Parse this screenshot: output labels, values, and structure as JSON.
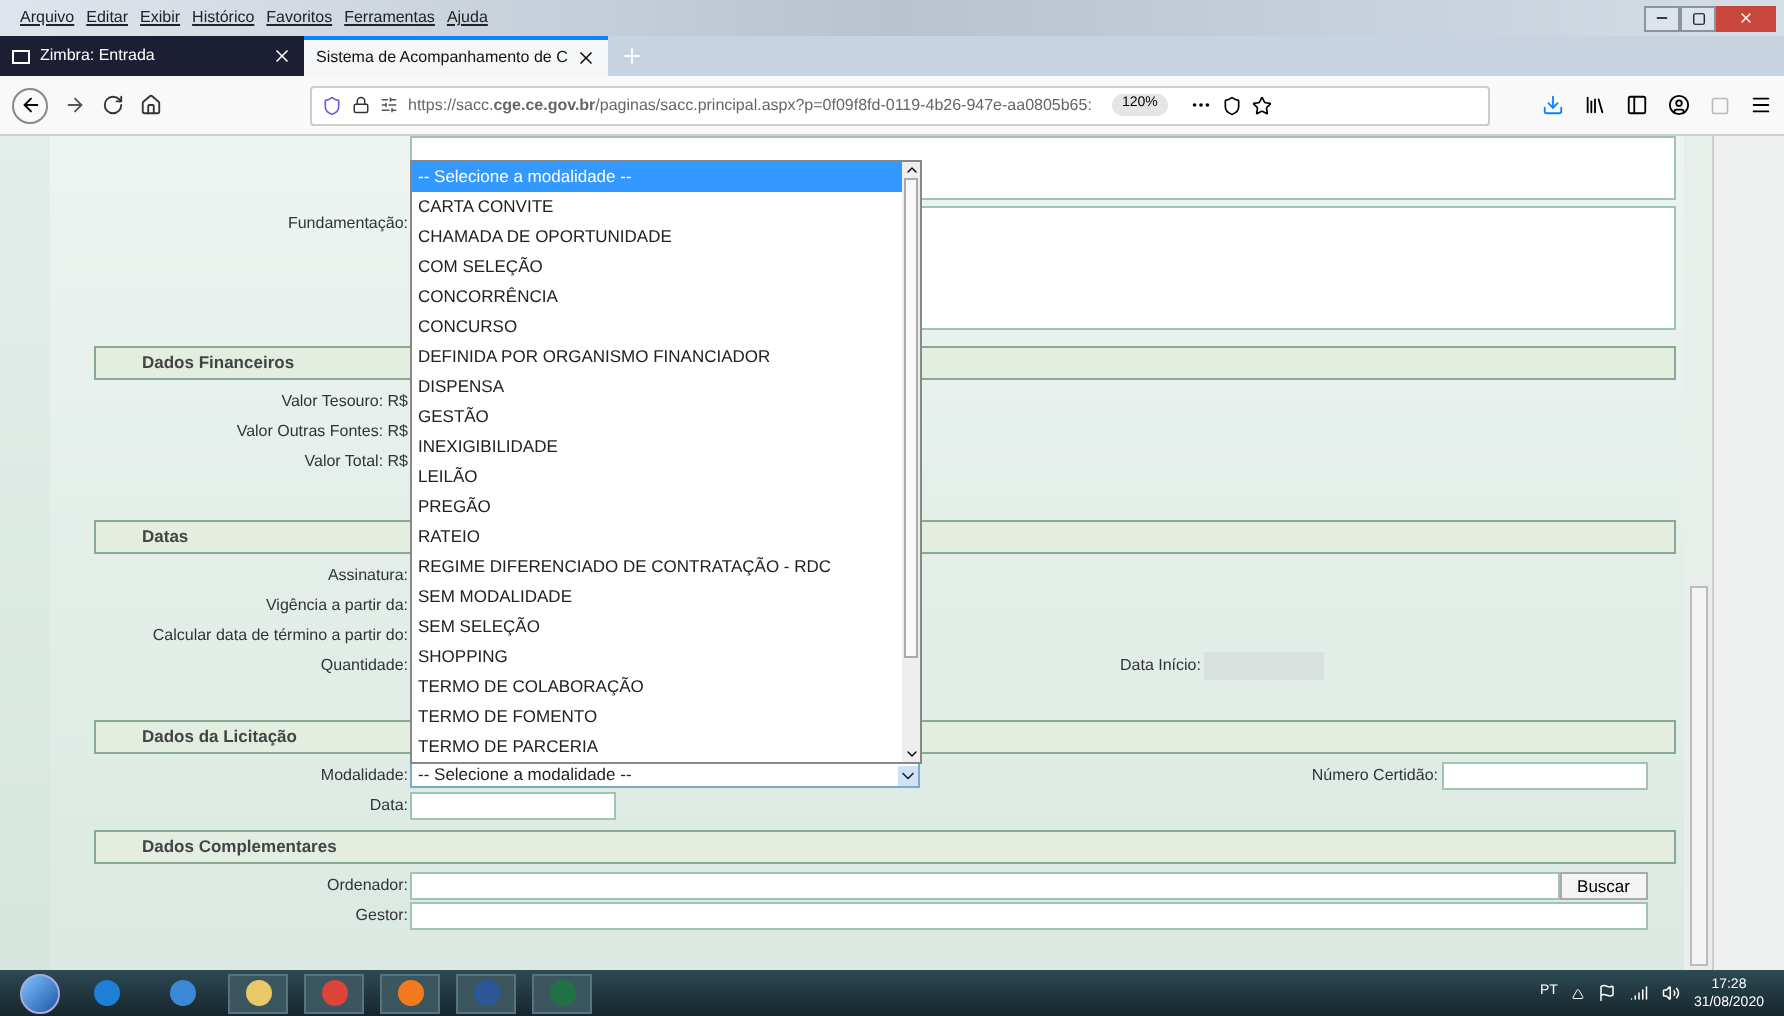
{
  "menu": [
    "Arquivo",
    "Editar",
    "Exibir",
    "Histórico",
    "Favoritos",
    "Ferramentas",
    "Ajuda"
  ],
  "tabs": [
    {
      "label": "Zimbra: Entrada",
      "selected": false
    },
    {
      "label": "Sistema de Acompanhamento de C",
      "selected": true
    }
  ],
  "address": {
    "url": "https://sacc.**cge.ce.gov.br**/paginas/sacc.principal.aspx?p=0f09f8fd-0119-4b26-947e-aa0805b65:",
    "zoom": "120%"
  },
  "fundamentacao": {
    "label": "Fundamentação:"
  },
  "sections": [
    {
      "title": "Dados Financeiros",
      "rows": [
        {
          "label": "Valor Tesouro: R$",
          "kind": "covered"
        },
        {
          "label": "Valor Outras Fontes: R$",
          "kind": "covered"
        },
        {
          "label": "Valor Total: R$",
          "kind": "covered"
        }
      ]
    },
    {
      "title": "Datas",
      "rows": [
        {
          "label": "Assinatura:",
          "kind": "covered"
        },
        {
          "label": "Vigência a partir da:",
          "kind": "covered"
        },
        {
          "label": "Calcular data de término a partir do:",
          "kind": "covered"
        },
        {
          "label": "Quantidade:",
          "kind": "covered",
          "extra": {
            "label": "Data Início:",
            "disabled": true
          }
        }
      ]
    },
    {
      "title": "Dados da Licitação",
      "rows": [
        {
          "label": "Modalidade:",
          "kind": "select",
          "value": "-- Selecione a modalidade --",
          "extra": {
            "label": "Número Certidão:",
            "disabled": false
          }
        },
        {
          "label": "Data:",
          "kind": "input"
        }
      ]
    },
    {
      "title": "Dados Complementares",
      "rows": [
        {
          "label": "Ordenador:",
          "kind": "input",
          "button": "Buscar"
        },
        {
          "label": "Gestor:",
          "kind": "input"
        }
      ]
    }
  ],
  "dropdown": {
    "expanded": true,
    "options": [
      {
        "label": "-- Selecione a modalidade --",
        "selected": true
      },
      {
        "label": "CARTA CONVITE",
        "selected": false
      },
      {
        "label": "CHAMADA DE OPORTUNIDADE",
        "selected": false
      },
      {
        "label": "COM SELEÇÃO",
        "selected": false
      },
      {
        "label": "CONCORRÊNCIA",
        "selected": false
      },
      {
        "label": "CONCURSO",
        "selected": false
      },
      {
        "label": "DEFINIDA POR ORGANISMO FINANCIADOR",
        "selected": false
      },
      {
        "label": "DISPENSA",
        "selected": false
      },
      {
        "label": "GESTÃO",
        "selected": false
      },
      {
        "label": "INEXIGIBILIDADE",
        "selected": false
      },
      {
        "label": "LEILÃO",
        "selected": false
      },
      {
        "label": "PREGÃO",
        "selected": false
      },
      {
        "label": "RATEIO",
        "selected": false
      },
      {
        "label": "REGIME DIFERENCIADO DE CONTRATAÇÃO - RDC",
        "selected": false
      },
      {
        "label": "SEM MODALIDADE",
        "selected": false
      },
      {
        "label": "SEM SELEÇÃO",
        "selected": false
      },
      {
        "label": "SHOPPING",
        "selected": false
      },
      {
        "label": "TERMO DE COLABORAÇÃO",
        "selected": false
      },
      {
        "label": "TERMO DE FOMENTO",
        "selected": false
      },
      {
        "label": "TERMO DE PARCERIA",
        "selected": false
      }
    ]
  },
  "taskbar": {
    "language": "PT",
    "time": "17:28",
    "date": "31/08/2020"
  }
}
